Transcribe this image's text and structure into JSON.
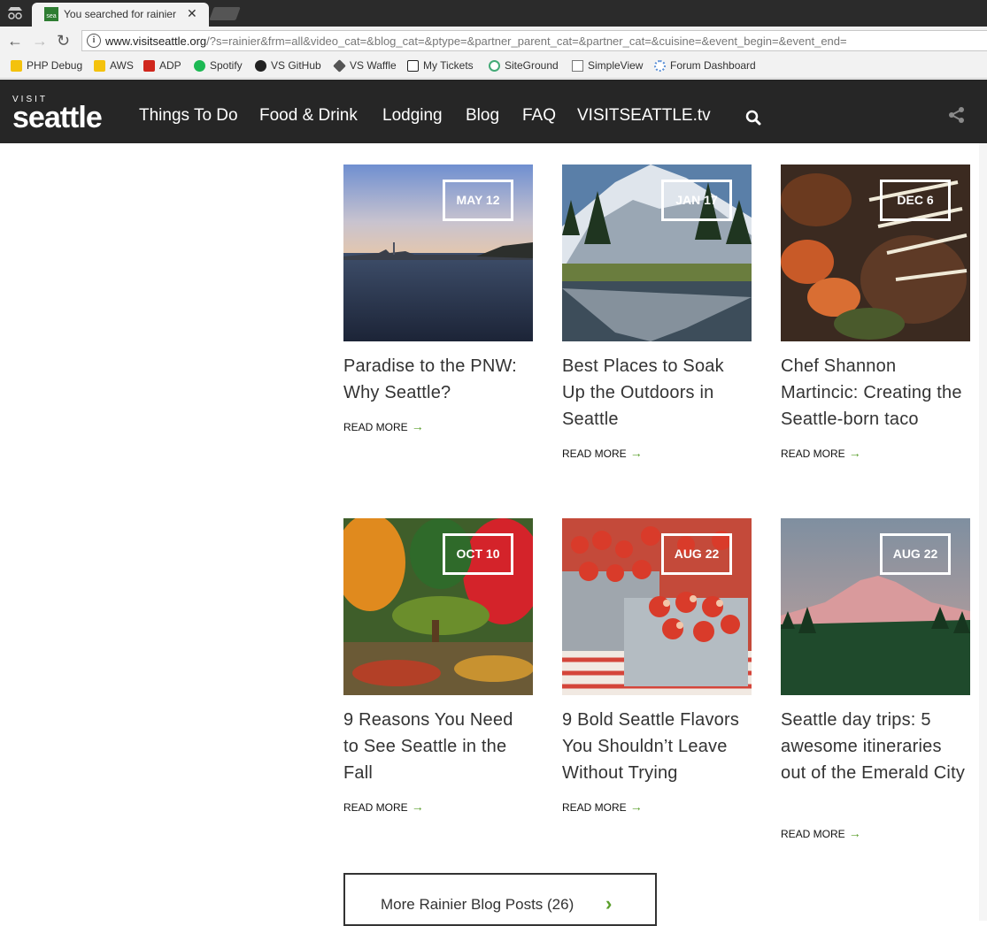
{
  "browser": {
    "tab_title": "You searched for rainier",
    "tab_favicon_text": "sea",
    "url_host": "www.visitseattle.org",
    "url_path": "/?s=rainier&frm=all&video_cat=&blog_cat=&ptype=&partner_parent_cat=&partner_cat=&cuisine=&event_begin=&event_end=",
    "bookmarks": [
      "PHP Debug",
      "AWS",
      "ADP",
      "Spotify",
      "VS GitHub",
      "VS Waffle",
      "My Tickets",
      "SiteGround",
      "SimpleView",
      "Forum Dashboard"
    ]
  },
  "site": {
    "logo_top": "VISIT",
    "logo_main": "seattle",
    "nav": [
      "Things To Do",
      "Food & Drink",
      "Lodging",
      "Blog",
      "FAQ",
      "VISITSEATTLE.tv"
    ]
  },
  "posts": [
    {
      "date": "MAY 12",
      "title": "Paradise to the PNW: Why Seattle?",
      "read_more": "READ MORE"
    },
    {
      "date": "JAN 17",
      "title": "Best Places to Soak Up the Outdoors in Seattle",
      "read_more": "READ MORE"
    },
    {
      "date": "DEC 6",
      "title": "Chef Shannon Martincic: Creating the Seattle-born taco",
      "read_more": "READ MORE"
    },
    {
      "date": "OCT 10",
      "title": "9 Reasons You Need to See Seattle in the Fall",
      "read_more": "READ MORE"
    },
    {
      "date": "AUG 22",
      "title": "9 Bold Seattle Flavors You Shouldn’t Leave Without Trying",
      "read_more": "READ MORE"
    },
    {
      "date": "AUG 22",
      "title": "Seattle day trips: 5 awesome itineraries out of the Emerald City",
      "read_more": "READ MORE"
    }
  ],
  "more_button": {
    "label": "More Rainier Blog Posts (26)"
  },
  "colors": {
    "header_bg": "#262626",
    "accent_green": "#5a9e2b"
  }
}
